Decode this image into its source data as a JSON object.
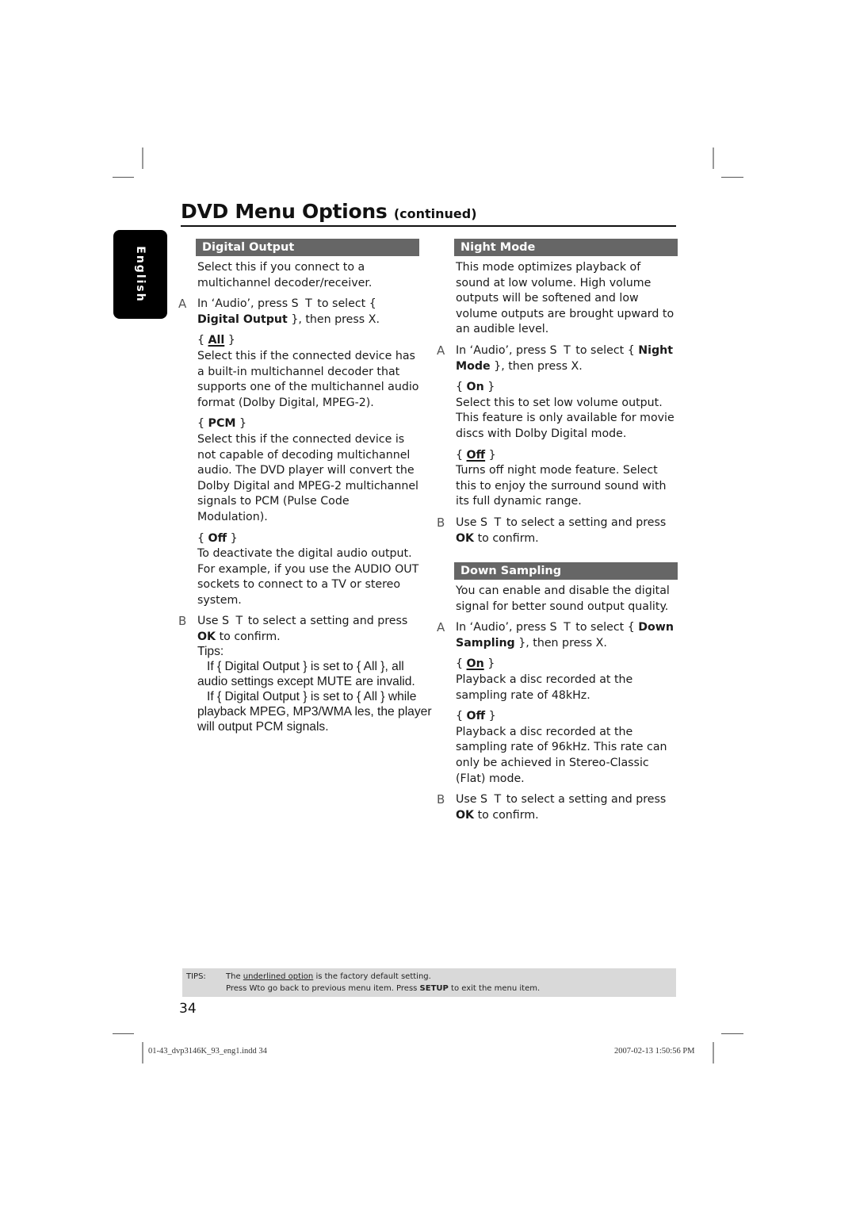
{
  "page": {
    "title": "DVD Menu Options",
    "title_suffix": "(continued)",
    "language_tab": "English",
    "page_number": "34"
  },
  "digital_output": {
    "header": "Digital Output",
    "intro": "Select this if you connect to a multichannel decoder/receiver.",
    "step_a": {
      "label": "A",
      "pre": "In ‘Audio’, press ",
      "keys": "S  T",
      "mid": " to select { ",
      "bold": "Digital Output",
      "post": " }, then press ",
      "key2": "X",
      "end": "."
    },
    "options": [
      {
        "name": "All",
        "default": true,
        "desc": "Select this if the connected device has a built-in multichannel decoder that supports one of the multichannel audio format (Dolby Digital, MPEG-2)."
      },
      {
        "name": "PCM",
        "default": false,
        "desc": "Select this if the connected device is not capable of decoding multichannel audio. The DVD player will convert the Dolby Digital and MPEG-2 multichannel signals to PCM (Pulse Code Modulation)."
      },
      {
        "name": "Off",
        "default": false,
        "desc": "To deactivate the digital audio output. For example, if you use the AUDIO OUT sockets to connect to a TV or stereo system."
      }
    ],
    "step_b": {
      "label": "B",
      "pre": "Use ",
      "keys": "S  T",
      "post": " to select a setting and press ",
      "bold": "OK",
      "end": " to confirm."
    }
  },
  "tips": {
    "heading": "Tips:",
    "line1a": "If { Digital Output } is set to { All }, all",
    "line1b": "audio settings except MUTE are invalid.",
    "line2a": "If { Digital Output } is set to { All } while",
    "line2b": "playback MPEG, MP3/WMA  les, the player",
    "line2c": "will output PCM signals."
  },
  "night_mode": {
    "header": "Night Mode",
    "intro": "This mode optimizes playback of sound at low volume. High volume outputs will be softened and low volume outputs are brought upward to an audible level.",
    "step_a": {
      "label": "A",
      "pre": "In ‘Audio’, press ",
      "keys": "S  T",
      "mid": " to select { ",
      "bold": "Night Mode",
      "post": " }, then press ",
      "key2": "X",
      "end": "."
    },
    "options": [
      {
        "name": "On",
        "default": false,
        "desc": "Select this to set low volume output. This feature is only available for movie discs with Dolby Digital mode."
      },
      {
        "name": "Off",
        "default": true,
        "desc": "Turns off night mode feature. Select this to enjoy the surround sound with its full dynamic range."
      }
    ],
    "step_b": {
      "label": "B",
      "pre": "Use ",
      "keys": "S  T",
      "post": " to select a setting and press ",
      "bold": "OK",
      "end": " to confirm."
    }
  },
  "down_sampling": {
    "header": "Down Sampling",
    "intro": "You can enable and disable the digital signal for better sound output quality.",
    "step_a": {
      "label": "A",
      "pre": "In ‘Audio’, press ",
      "keys": "S  T",
      "mid": " to select { ",
      "bold": "Down Sampling",
      "post": " }, then press ",
      "key2": "X",
      "end": "."
    },
    "options": [
      {
        "name": "On",
        "default": true,
        "desc": "Playback a disc recorded at the sampling rate of 48kHz."
      },
      {
        "name": "Off",
        "default": false,
        "desc": "Playback a disc recorded at the sampling rate of 96kHz. This rate can only be achieved in Stereo-Classic (Flat) mode."
      }
    ],
    "step_b": {
      "label": "B",
      "pre": "Use ",
      "keys": "S  T",
      "post": " to select a setting and press ",
      "bold": "OK",
      "end": " to confirm."
    }
  },
  "tips_bar": {
    "key": "TIPS:",
    "line1_pre": "The ",
    "line1_underlined": "underlined option",
    "line1_post": " is the factory default setting.",
    "line2_pre": "Press   W",
    "line2_mid": "to go back to previous menu item. Press ",
    "line2_bold": "SETUP",
    "line2_post": " to exit the menu item."
  },
  "footer": {
    "file": "01-43_dvp3146K_93_eng1.indd   34",
    "timestamp": "2007-02-13   1:50:56 PM"
  }
}
